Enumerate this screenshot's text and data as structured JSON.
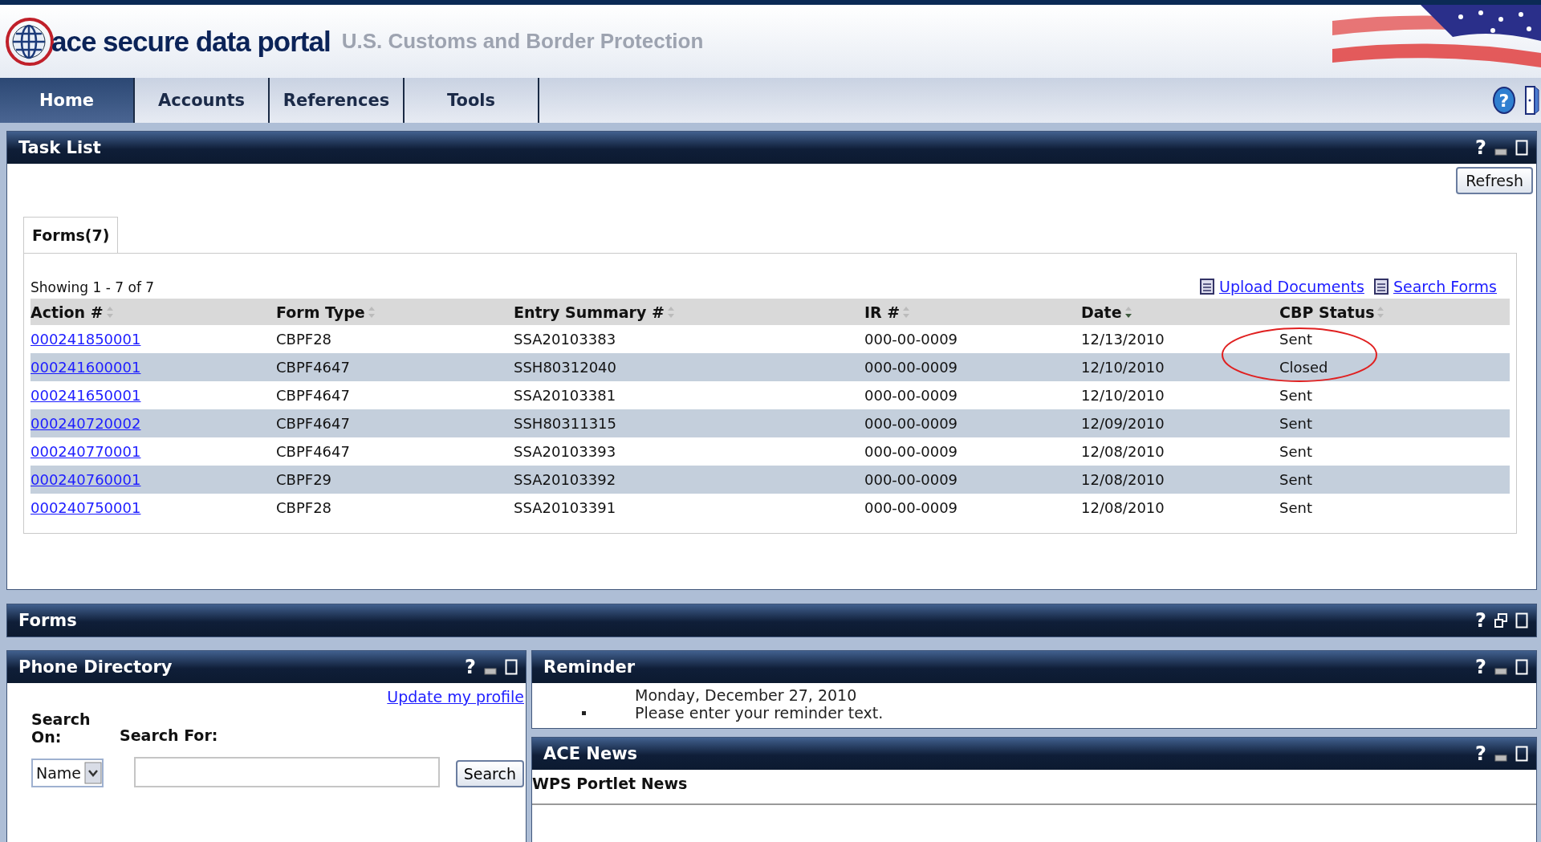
{
  "header": {
    "logo_text": "ace secure data portal",
    "agency": "U.S. Customs and Border Protection"
  },
  "nav": {
    "tabs": [
      {
        "label": "Home",
        "selected": true
      },
      {
        "label": "Accounts",
        "selected": false
      },
      {
        "label": "References",
        "selected": false
      },
      {
        "label": "Tools",
        "selected": false
      }
    ],
    "help_label": "?"
  },
  "task_list": {
    "title": "Task List",
    "controls": [
      {
        "kind": "help",
        "label": "?"
      },
      {
        "kind": "minimize"
      },
      {
        "kind": "maximize"
      }
    ],
    "refresh_button": "Refresh",
    "tabs": [
      {
        "label": "Forms(7)",
        "selected": true
      }
    ],
    "showing": "Showing 1 - 7 of 7",
    "links": [
      "Upload Documents",
      "Search Forms"
    ],
    "columns": [
      {
        "label": "Action #",
        "sorted": false
      },
      {
        "label": "Form Type",
        "sorted": false
      },
      {
        "label": "Entry Summary #",
        "sorted": false
      },
      {
        "label": "IR #",
        "sorted": false
      },
      {
        "label": "Date",
        "sorted": true
      },
      {
        "label": "CBP Status",
        "sorted": false
      }
    ],
    "rows": [
      [
        "000241850001",
        "CBPF28",
        "SSA20103383",
        "000-00-0009",
        "12/13/2010",
        "Sent"
      ],
      [
        "000241600001",
        "CBPF4647",
        "SSH80312040",
        "000-00-0009",
        "12/10/2010",
        "Closed"
      ],
      [
        "000241650001",
        "CBPF4647",
        "SSA20103381",
        "000-00-0009",
        "12/10/2010",
        "Sent"
      ],
      [
        "000240720002",
        "CBPF4647",
        "SSH80311315",
        "000-00-0009",
        "12/09/2010",
        "Sent"
      ],
      [
        "000240770001",
        "CBPF4647",
        "SSA20103393",
        "000-00-0009",
        "12/08/2010",
        "Sent"
      ],
      [
        "000240760001",
        "CBPF29",
        "SSA20103392",
        "000-00-0009",
        "12/08/2010",
        "Sent"
      ],
      [
        "000240750001",
        "CBPF28",
        "SSA20103391",
        "000-00-0009",
        "12/08/2010",
        "Sent"
      ]
    ]
  },
  "forms": {
    "title": "Forms",
    "controls": [
      {
        "kind": "help",
        "label": "?"
      },
      {
        "kind": "restore"
      },
      {
        "kind": "maximize"
      }
    ]
  },
  "phone_directory": {
    "title": "Phone Directory",
    "controls": [
      {
        "kind": "help",
        "label": "?"
      },
      {
        "kind": "minimize"
      },
      {
        "kind": "maximize"
      }
    ],
    "profile_link": "Update my profile",
    "search_on_label": "Search On:",
    "search_for_label": "Search For:",
    "select_value": "Name",
    "search_button": "Search"
  },
  "reminder": {
    "title": "Reminder",
    "controls": [
      {
        "kind": "help",
        "label": "?"
      },
      {
        "kind": "minimize"
      },
      {
        "kind": "maximize"
      }
    ],
    "date": "Monday, December 27, 2010",
    "text": "Please enter your reminder text."
  },
  "ace_news": {
    "title": "ACE News",
    "controls": [
      {
        "kind": "help",
        "label": "?"
      },
      {
        "kind": "minimize"
      },
      {
        "kind": "maximize"
      }
    ],
    "heading": "WPS Portlet News"
  }
}
